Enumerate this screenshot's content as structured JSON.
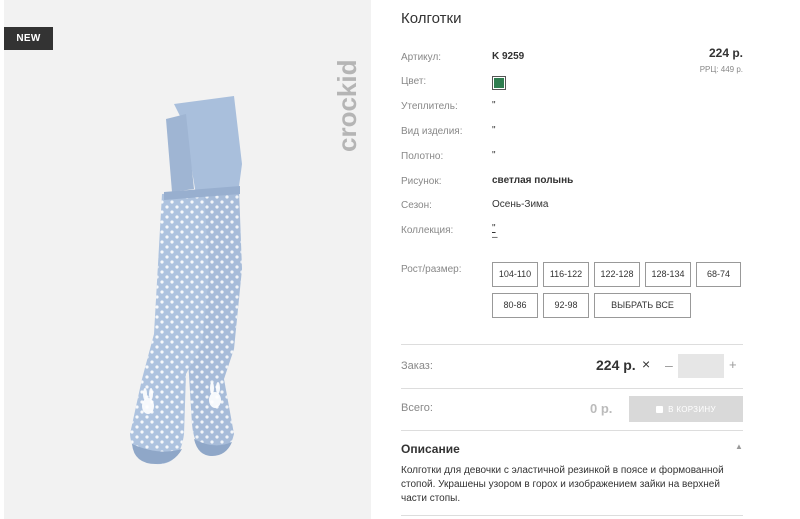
{
  "badge": "NEW",
  "brand": "crockid",
  "product": {
    "title": "Колготки",
    "price": "224 р.",
    "rrp": "РРЦ: 449 р."
  },
  "attributes": {
    "article_label": "Артикул:",
    "article_value": "K 9259",
    "color_label": "Цвет:",
    "color_hex": "#2e7d4f",
    "insulation_label": "Утеплитель:",
    "insulation_value": "\"",
    "type_label": "Вид изделия:",
    "type_value": "\"",
    "fabric_label": "Полотно:",
    "fabric_value": "\"",
    "pattern_label": "Рисунок:",
    "pattern_value": "светлая полынь",
    "season_label": "Сезон:",
    "season_value": "Осень-Зима",
    "collection_label": "Коллекция:",
    "collection_value": "\"",
    "collection_extra": "–"
  },
  "sizes": {
    "label": "Рост/размер:",
    "options": [
      "104-110",
      "116-122",
      "122-128",
      "128-134",
      "68-74",
      "80-86",
      "92-98"
    ],
    "select_all": "ВЫБРАТЬ ВСЕ"
  },
  "order": {
    "label": "Заказ:",
    "price": "224 р.",
    "times_icon": "×",
    "minus_icon": "–",
    "plus_icon": "+",
    "quantity": ""
  },
  "total": {
    "label": "Всего:",
    "price": "0 р.",
    "cart_button": "В КОРЗИНУ",
    "cart_icon": "shopping-bag-icon"
  },
  "description": {
    "title": "Описание",
    "caret_icon": "▲",
    "text": "Колготки для девочки с эластичной резинкой в поясе и формованной стопой. Украшены узором в горох и изображением зайки на верхней части стопы."
  }
}
